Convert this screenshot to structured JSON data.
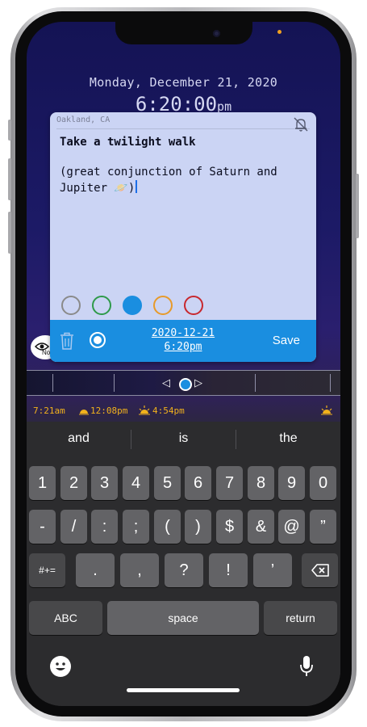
{
  "status": {
    "time_header_date": "Monday, December 21, 2020",
    "time_header_time": "6:20:00",
    "time_header_ampm": "pm"
  },
  "card": {
    "location": "Oakland, CA",
    "note_title": "Take a twilight walk",
    "note_body_line1": "(great conjunction of Saturn and",
    "note_body_line2": "Jupiter 🪐)",
    "swatch_colors": [
      "#8a8a8a",
      "#2f9a4a",
      "#1a8ee0",
      "#e79a2a",
      "#c8282e"
    ],
    "selected_swatch": 2,
    "date_value": "2020-12-21",
    "time_value": "6:20pm",
    "save_label": "Save",
    "bar_color": "#1a8ee0"
  },
  "badge": {
    "label": "No"
  },
  "timeline": {
    "left_arrow": "◁",
    "right_arrow": "▷"
  },
  "events": [
    {
      "time": "7:21am",
      "icon": "sunrise-icon"
    },
    {
      "time": "12:08pm",
      "icon": "solar-noon-icon"
    },
    {
      "time": "4:54pm",
      "icon": "sunset-icon"
    }
  ],
  "keyboard": {
    "predictions": [
      "and",
      "is",
      "the"
    ],
    "row1": [
      "1",
      "2",
      "3",
      "4",
      "5",
      "6",
      "7",
      "8",
      "9",
      "0"
    ],
    "row2": [
      "-",
      "/",
      ":",
      ";",
      "(",
      ")",
      "$",
      "&",
      "@",
      "”"
    ],
    "row3_mode": "#+=",
    "row3": [
      ".",
      ",",
      "?",
      "!",
      "’"
    ],
    "abc": "ABC",
    "space": "space",
    "return": "return"
  }
}
